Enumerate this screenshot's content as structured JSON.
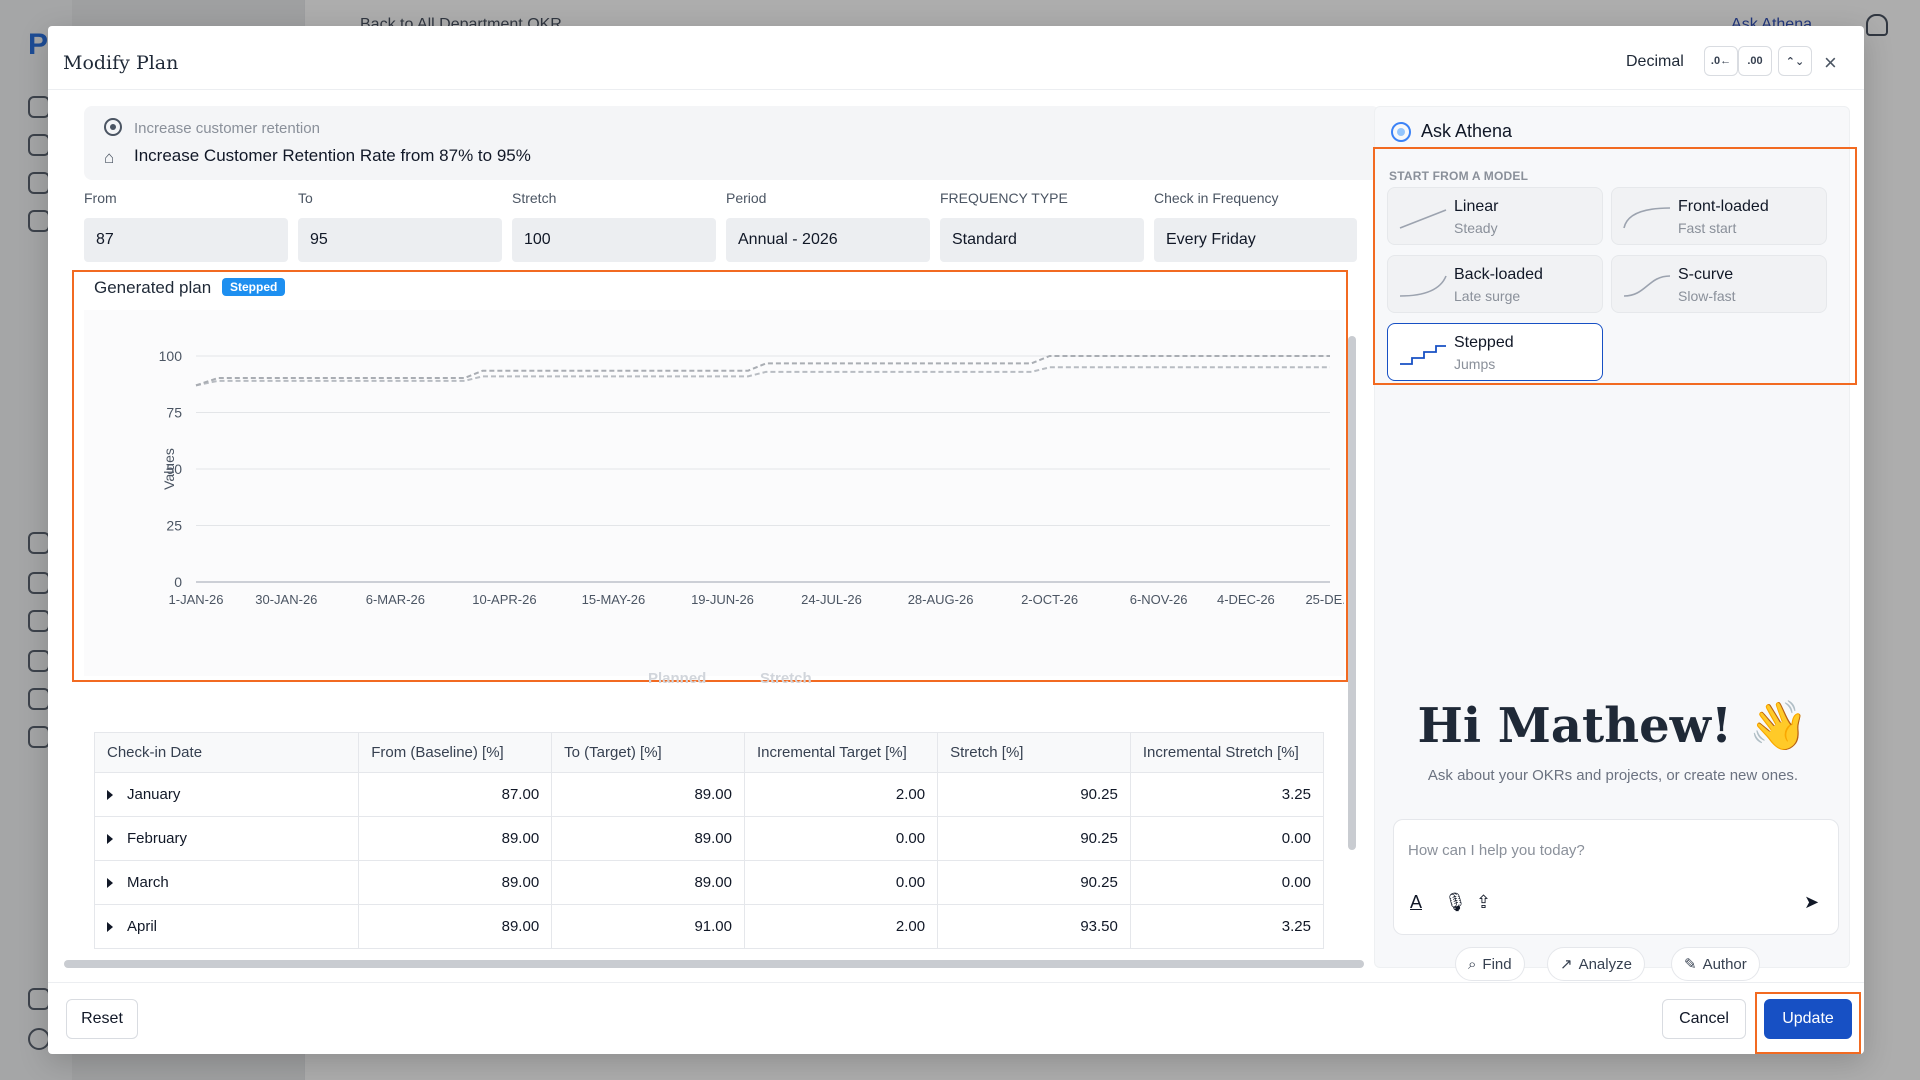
{
  "background": {
    "logo": "P",
    "breadcrumb": "Back to All Department OKR",
    "ask_athena": "Ask Athena"
  },
  "modal": {
    "title": "Modify Plan",
    "decimal_label": "Decimal",
    "decimal_decrease": ".0←",
    ".decimal_increase": ".00",
    "decimal_increase": ".00→",
    "close": "×"
  },
  "objective": {
    "parent": "Increase customer retention",
    "key_result": "Increase Customer Retention Rate from 87% to 95%"
  },
  "fields": [
    {
      "label": "From",
      "value": "87"
    },
    {
      "label": "To",
      "value": "95"
    },
    {
      "label": "Stretch",
      "value": "100"
    },
    {
      "label": "Period",
      "value": "Annual - 2026"
    },
    {
      "label": "FREQUENCY TYPE",
      "value": "Standard"
    },
    {
      "label": "Check in Frequency",
      "value": "Every Friday"
    }
  ],
  "plan": {
    "title": "Generated plan",
    "badge": "Stepped"
  },
  "chart_data": {
    "type": "line",
    "title": "",
    "xlabel": "",
    "ylabel": "Values",
    "ylim": [
      0,
      100
    ],
    "yticks": [
      "100",
      "75",
      "50",
      "25",
      "0"
    ],
    "x_tick_labels": [
      "1-JAN-26",
      "30-JAN-26",
      "6-MAR-26",
      "10-APR-26",
      "15-MAY-26",
      "19-JUN-26",
      "24-JUL-26",
      "28-AUG-26",
      "2-OCT-26",
      "6-NOV-26",
      "4-DEC-26",
      "25-DE..."
    ],
    "series": [
      {
        "name": "Planned",
        "color": "#b8bcc2",
        "x": [
          "1-JAN-26",
          "8-JAN-26",
          "3-APR-26",
          "3-JUL-26",
          "2-OCT-26",
          "31-DEC-26"
        ],
        "values": [
          87,
          89,
          91,
          93,
          95,
          95
        ]
      },
      {
        "name": "Stretch",
        "color": "#a9adb3",
        "x": [
          "1-JAN-26",
          "8-JAN-26",
          "3-APR-26",
          "3-JUL-26",
          "2-OCT-26",
          "31-DEC-26"
        ],
        "values": [
          87,
          90.25,
          93.5,
          96.75,
          100,
          100
        ]
      }
    ],
    "grid": true,
    "legend": "bottom"
  },
  "table": {
    "headers": [
      "Check-in Date",
      "From (Baseline) [%]",
      "To (Target) [%]",
      "Incremental Target [%]",
      "Stretch [%]",
      "Incremental Stretch [%]"
    ],
    "rows": [
      [
        "January",
        "87.00",
        "89.00",
        "2.00",
        "90.25",
        "3.25"
      ],
      [
        "February",
        "89.00",
        "89.00",
        "0.00",
        "90.25",
        "0.00"
      ],
      [
        "March",
        "89.00",
        "89.00",
        "0.00",
        "90.25",
        "0.00"
      ],
      [
        "April",
        "89.00",
        "91.00",
        "2.00",
        "93.50",
        "3.25"
      ]
    ]
  },
  "footer": {
    "reset": "Reset",
    "cancel": "Cancel",
    "update": "Update"
  },
  "athena": {
    "title": "Ask Athena",
    "model_section": "START FROM A MODEL",
    "models": [
      {
        "name": "Linear",
        "sub": "Steady"
      },
      {
        "name": "Front-loaded",
        "sub": "Fast start"
      },
      {
        "name": "Back-loaded",
        "sub": "Late surge"
      },
      {
        "name": "S-curve",
        "sub": "Slow-fast"
      },
      {
        "name": "Stepped",
        "sub": "Jumps"
      }
    ],
    "selected_model": "Stepped",
    "greeting": "Hi Mathew! 👋",
    "greeting_sub": "Ask about your OKRs and projects, or create new ones.",
    "prompt_placeholder": "How can I help you today?",
    "chips": [
      "Find",
      "Analyze",
      "Author"
    ],
    "accent": "#1750c4"
  }
}
